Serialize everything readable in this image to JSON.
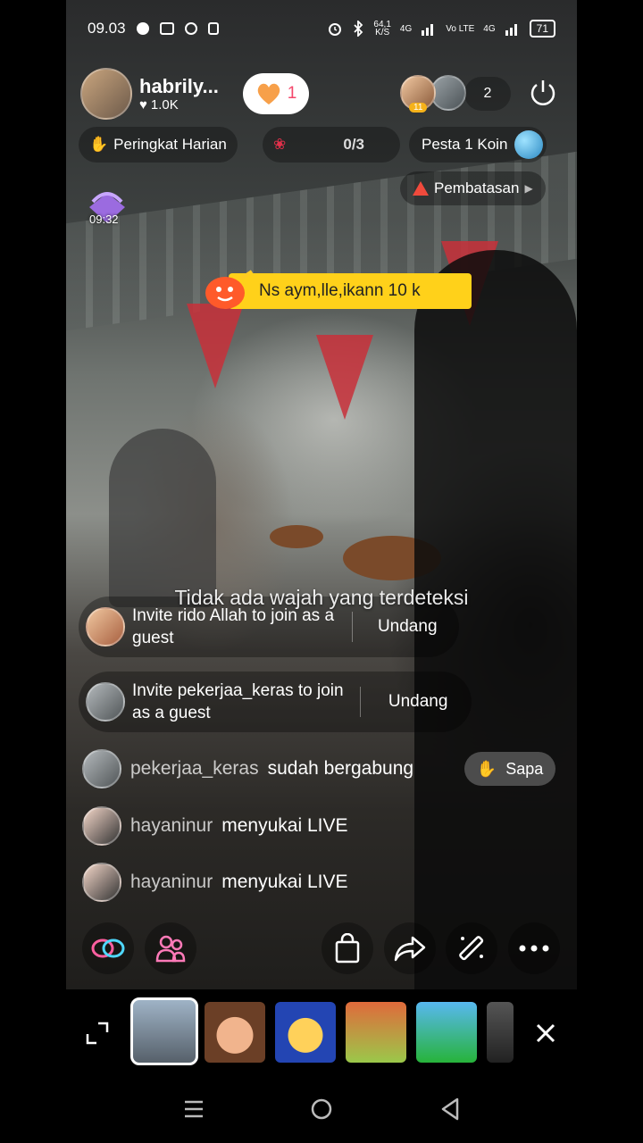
{
  "status_bar": {
    "time": "09.03",
    "net_speed_top": "64,1",
    "net_speed_unit": "K/S",
    "sig1": "4G",
    "sig2": "Vo LTE",
    "sig3": "4G",
    "battery": "71"
  },
  "host": {
    "name": "habrily...",
    "likes": "1.0K"
  },
  "follow": {
    "count": "1"
  },
  "viewers": {
    "count": "2",
    "badge": "11"
  },
  "rank": {
    "label": "Peringkat Harian"
  },
  "gift_goal": {
    "progress": "0/3"
  },
  "party": {
    "label": "Pesta 1 Koin"
  },
  "restriction": {
    "label": "Pembatasan"
  },
  "gift_timer": "09:32",
  "pinned": {
    "text": "Ns aym,lle,ikann 10 k"
  },
  "face_notice": "Tidak ada wajah yang terdeteksi",
  "invites": [
    {
      "text": "Invite rido Allah to join as a guest",
      "button": "Undang"
    },
    {
      "text": "Invite pekerjaa_keras to join as a guest",
      "button": "Undang"
    }
  ],
  "messages": [
    {
      "user": "pekerjaa_keras",
      "text": "sudah bergabung"
    },
    {
      "user": "hayaninur",
      "text": "menyukai LIVE"
    },
    {
      "user": "hayaninur",
      "text": "menyukai LIVE"
    }
  ],
  "sapa_button": "Sapa",
  "icons": {
    "toolbar": [
      "cohost-icon",
      "guests-icon",
      "shopping-bag-icon",
      "share-icon",
      "magic-wand-icon",
      "more-icon"
    ],
    "nav": [
      "recent-apps-icon",
      "home-icon",
      "back-icon"
    ]
  },
  "colors": {
    "accent": "#f4476b",
    "pinned_bg": "#ffd11a",
    "warning": "#f04a3c"
  }
}
